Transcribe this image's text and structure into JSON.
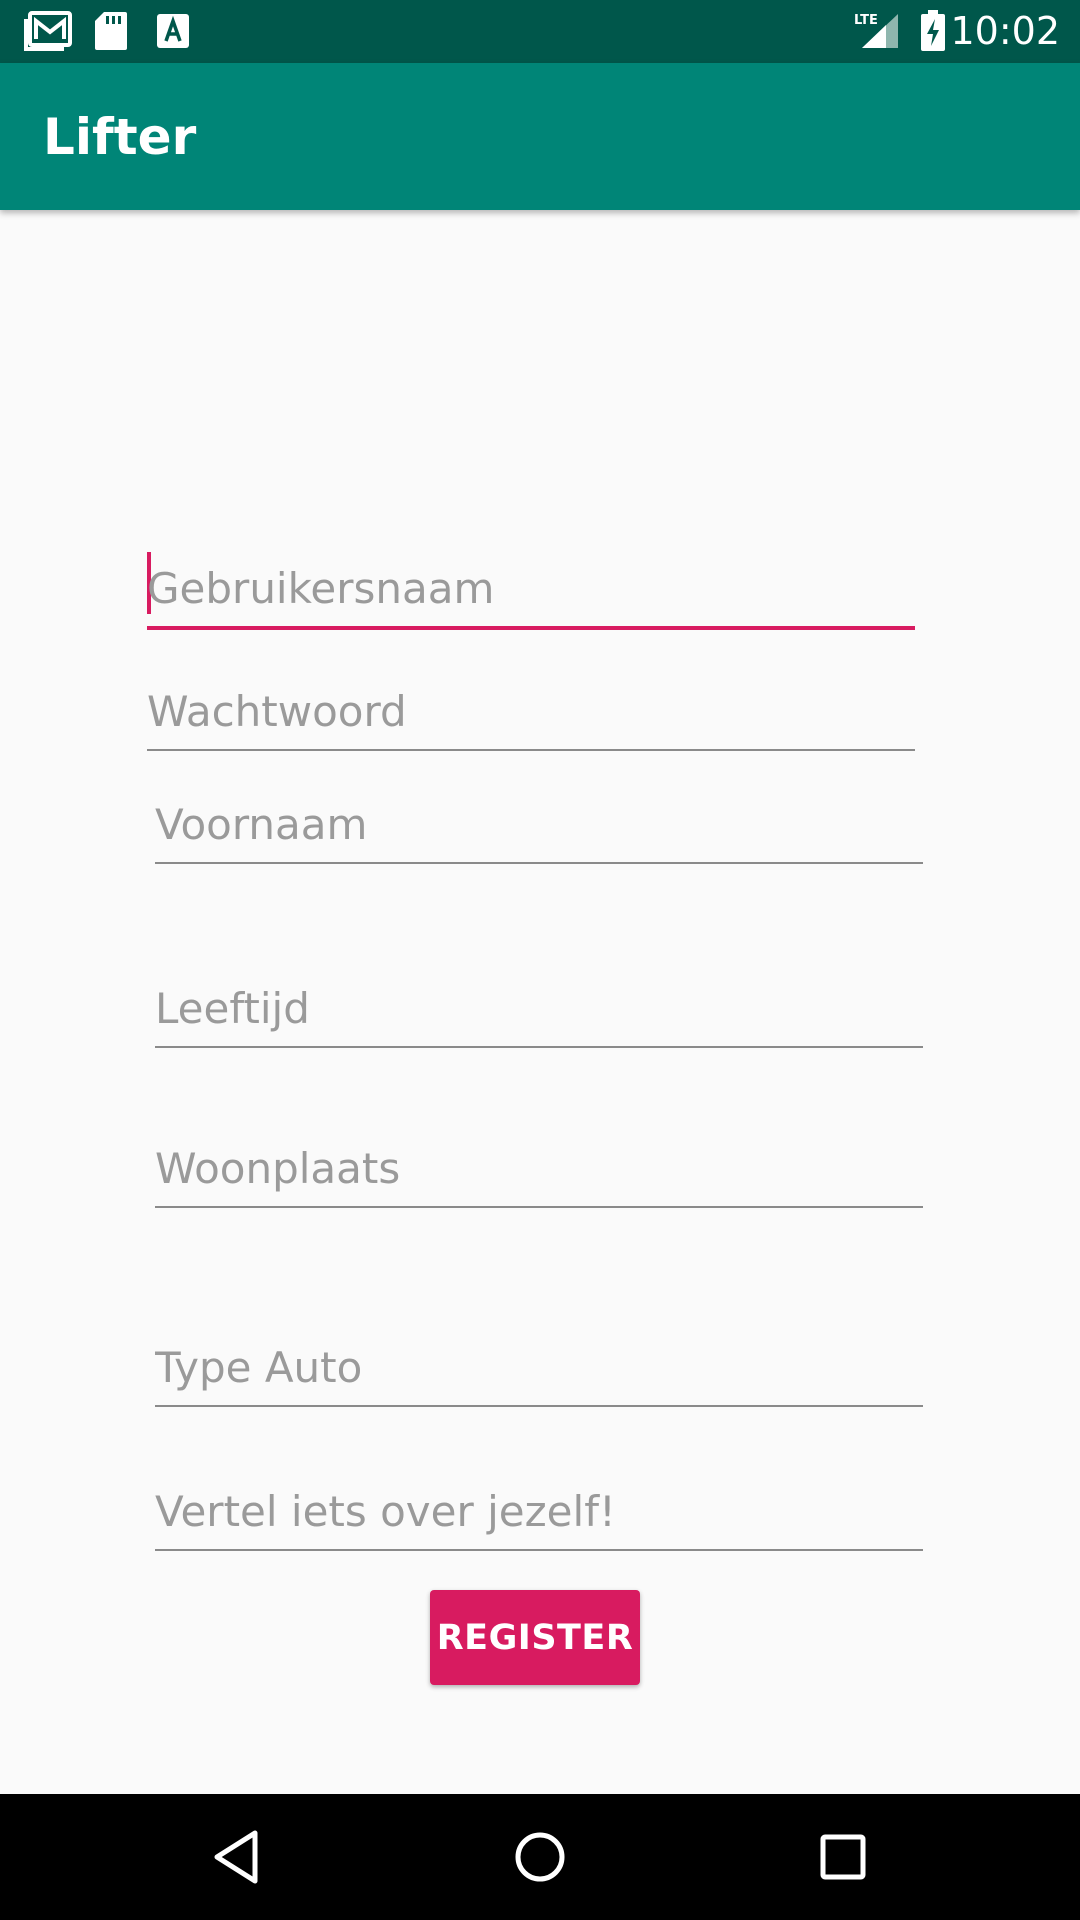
{
  "status_bar": {
    "time": "10:02",
    "icons": [
      "gmail-icon",
      "sd-card-icon",
      "font-download-icon",
      "lte-signal-icon",
      "battery-charging-icon"
    ],
    "network_label": "LTE"
  },
  "app_bar": {
    "title": "Lifter",
    "color": "#008577"
  },
  "form": {
    "fields": [
      {
        "name": "username",
        "placeholder": "Gebruikersnaam",
        "value": "",
        "focused": true
      },
      {
        "name": "password",
        "placeholder": "Wachtwoord",
        "value": "",
        "focused": false
      },
      {
        "name": "firstname",
        "placeholder": "Voornaam",
        "value": "",
        "focused": false
      },
      {
        "name": "age",
        "placeholder": "Leeftijd",
        "value": "",
        "focused": false
      },
      {
        "name": "city",
        "placeholder": "Woonplaats",
        "value": "",
        "focused": false
      },
      {
        "name": "car-type",
        "placeholder": "Type Auto",
        "value": "",
        "focused": false
      },
      {
        "name": "about",
        "placeholder": "Vertel iets over jezelf!",
        "value": "",
        "focused": false
      }
    ],
    "register_label": "REGISTER",
    "accent_color": "#d81b60"
  },
  "nav_bar": {
    "buttons": [
      "back-icon",
      "home-icon",
      "recents-icon"
    ]
  }
}
